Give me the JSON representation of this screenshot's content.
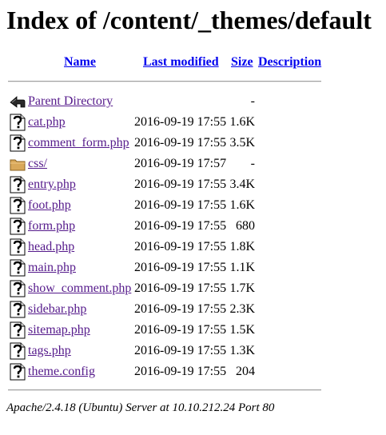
{
  "page": {
    "title": "Index of /content/_themes/default"
  },
  "columns": {
    "name": "Name",
    "last_modified": "Last modified",
    "size": "Size",
    "description": "Description"
  },
  "parent": {
    "label": "Parent Directory",
    "size": "-",
    "icon": "back-arrow-icon"
  },
  "entries": [
    {
      "name": "cat.php",
      "modified": "2016-09-19 17:55",
      "size": "1.6K",
      "icon": "unknown-file-icon"
    },
    {
      "name": "comment_form.php",
      "modified": "2016-09-19 17:55",
      "size": "3.5K",
      "icon": "unknown-file-icon"
    },
    {
      "name": "css/",
      "modified": "2016-09-19 17:57",
      "size": "-",
      "icon": "folder-icon"
    },
    {
      "name": "entry.php",
      "modified": "2016-09-19 17:55",
      "size": "3.4K",
      "icon": "unknown-file-icon"
    },
    {
      "name": "foot.php",
      "modified": "2016-09-19 17:55",
      "size": "1.6K",
      "icon": "unknown-file-icon"
    },
    {
      "name": "form.php",
      "modified": "2016-09-19 17:55",
      "size": "680",
      "icon": "unknown-file-icon"
    },
    {
      "name": "head.php",
      "modified": "2016-09-19 17:55",
      "size": "1.8K",
      "icon": "unknown-file-icon"
    },
    {
      "name": "main.php",
      "modified": "2016-09-19 17:55",
      "size": "1.1K",
      "icon": "unknown-file-icon"
    },
    {
      "name": "show_comment.php",
      "modified": "2016-09-19 17:55",
      "size": "1.7K",
      "icon": "unknown-file-icon"
    },
    {
      "name": "sidebar.php",
      "modified": "2016-09-19 17:55",
      "size": "2.3K",
      "icon": "unknown-file-icon"
    },
    {
      "name": "sitemap.php",
      "modified": "2016-09-19 17:55",
      "size": "1.5K",
      "icon": "unknown-file-icon"
    },
    {
      "name": "tags.php",
      "modified": "2016-09-19 17:55",
      "size": "1.3K",
      "icon": "unknown-file-icon"
    },
    {
      "name": "theme.config",
      "modified": "2016-09-19 17:55",
      "size": "204",
      "icon": "unknown-file-icon"
    }
  ],
  "footer": {
    "address": "Apache/2.4.18 (Ubuntu) Server at 10.10.212.24 Port 80"
  },
  "colors": {
    "link": "#0000ee",
    "visited_link": "#551a8b",
    "rule": "#a0a0a0"
  }
}
